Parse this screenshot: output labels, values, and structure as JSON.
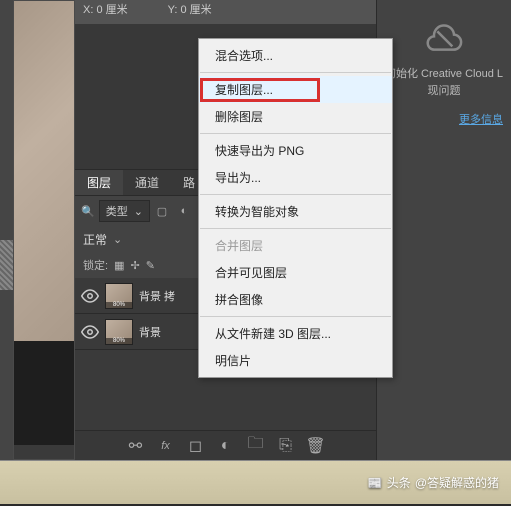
{
  "coords": {
    "x": "X: 0 厘米",
    "y": "Y: 0 厘米"
  },
  "tabs": {
    "layers": "图层",
    "channels": "通道",
    "paths": "路"
  },
  "filter_label": "类型",
  "blend_mode": "正常",
  "lock_label": "锁定:",
  "layers": [
    {
      "name": "背景 拷"
    },
    {
      "name": "背景"
    }
  ],
  "menu": {
    "blending": "混合选项...",
    "duplicate": "复制图层...",
    "delete": "删除图层",
    "quick_export": "快速导出为 PNG",
    "export_as": "导出为...",
    "smart_object": "转换为智能对象",
    "merge_layers": "合并图层",
    "merge_visible": "合并可见图层",
    "flatten": "拼合图像",
    "new_3d": "从文件新建 3D 图层...",
    "postcard": "明信片"
  },
  "cc_panel": {
    "text1": "初始化 Creative Cloud L",
    "text2": "现问题",
    "more": "更多信息"
  },
  "watermark": {
    "prefix": "头条",
    "user": "@答疑解惑的猪"
  }
}
